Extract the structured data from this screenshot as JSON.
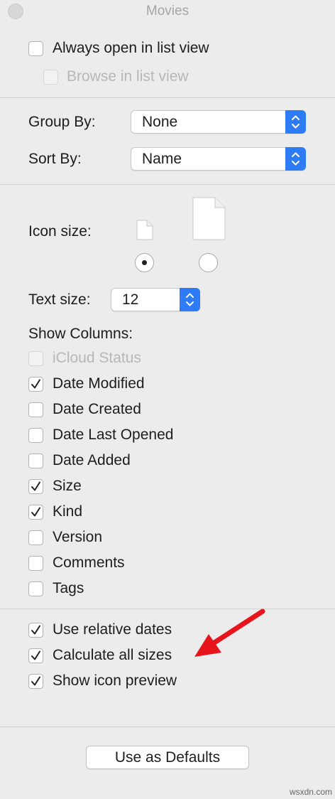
{
  "window": {
    "title": "Movies"
  },
  "options": {
    "always_open_list": {
      "label": "Always open in list view",
      "checked": false
    },
    "browse_list": {
      "label": "Browse in list view",
      "checked": false,
      "enabled": false
    }
  },
  "group_by": {
    "label": "Group By:",
    "value": "None"
  },
  "sort_by": {
    "label": "Sort By:",
    "value": "Name"
  },
  "icon_size": {
    "label": "Icon size:",
    "selected": "small"
  },
  "text_size": {
    "label": "Text size:",
    "value": "12"
  },
  "show_columns": {
    "label": "Show Columns:",
    "items": [
      {
        "label": "iCloud Status",
        "checked": false,
        "enabled": false
      },
      {
        "label": "Date Modified",
        "checked": true
      },
      {
        "label": "Date Created",
        "checked": false
      },
      {
        "label": "Date Last Opened",
        "checked": false
      },
      {
        "label": "Date Added",
        "checked": false
      },
      {
        "label": "Size",
        "checked": true
      },
      {
        "label": "Kind",
        "checked": true
      },
      {
        "label": "Version",
        "checked": false
      },
      {
        "label": "Comments",
        "checked": false
      },
      {
        "label": "Tags",
        "checked": false
      }
    ]
  },
  "bottom_options": [
    {
      "label": "Use relative dates",
      "checked": true
    },
    {
      "label": "Calculate all sizes",
      "checked": true
    },
    {
      "label": "Show icon preview",
      "checked": true
    }
  ],
  "defaults_button": {
    "label": "Use as Defaults"
  },
  "watermark": "wsxdn.com",
  "colors": {
    "accent": "#2d7cf6",
    "annotation_arrow": "#e8141b"
  }
}
